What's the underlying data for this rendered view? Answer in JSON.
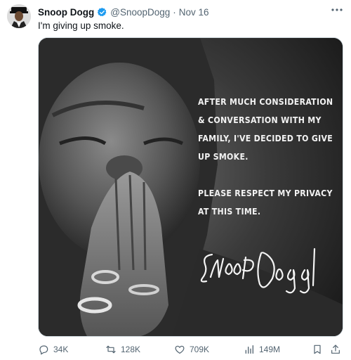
{
  "author": {
    "name": "Snoop Dogg",
    "handle": "@SnoopDogg",
    "separator": "·",
    "date": "Nov 16",
    "verified": true
  },
  "tweet": {
    "text": "I'm giving up smoke."
  },
  "media": {
    "statement_lines": [
      "AFTER MUCH CONSIDERATION & CONVERSATION WITH MY FAMILY, I'VE DECIDED TO GIVE UP SMOKE.",
      "PLEASE RESPECT MY PRIVACY AT THIS TIME."
    ],
    "signature_text": "Snoop Dogg"
  },
  "actions": {
    "replies": "34K",
    "reposts": "128K",
    "likes": "709K",
    "views": "149M"
  },
  "colors": {
    "text": "#0f1419",
    "secondary": "#536471",
    "verified_blue": "#1d9bf0"
  },
  "icons": [
    "verified-badge-icon",
    "more-icon",
    "reply-icon",
    "repost-icon",
    "like-icon",
    "views-icon",
    "bookmark-icon",
    "share-icon"
  ]
}
